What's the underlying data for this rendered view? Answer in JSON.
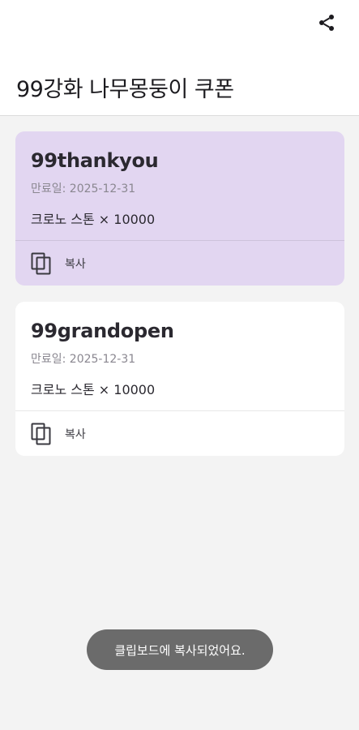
{
  "header": {
    "title": "99강화 나무몽둥이 쿠폰",
    "share_icon": "share-icon"
  },
  "coupons": [
    {
      "code": "99thankyou",
      "expiry": "만료일: 2025-12-31",
      "reward": "크로노 스톤 × 10000",
      "copy_label": "복사",
      "copy_icon": "copy-icon",
      "selected": true
    },
    {
      "code": "99grandopen",
      "expiry": "만료일: 2025-12-31",
      "reward": "크로노 스톤 × 10000",
      "copy_label": "복사",
      "copy_icon": "copy-icon",
      "selected": false
    }
  ],
  "toast": {
    "message": "클립보드에 복사되었어요."
  },
  "colors": {
    "selected_card": "#e2d6f1",
    "card": "#ffffff",
    "background": "#f3f3f3",
    "toast": "#6b6b6b"
  }
}
